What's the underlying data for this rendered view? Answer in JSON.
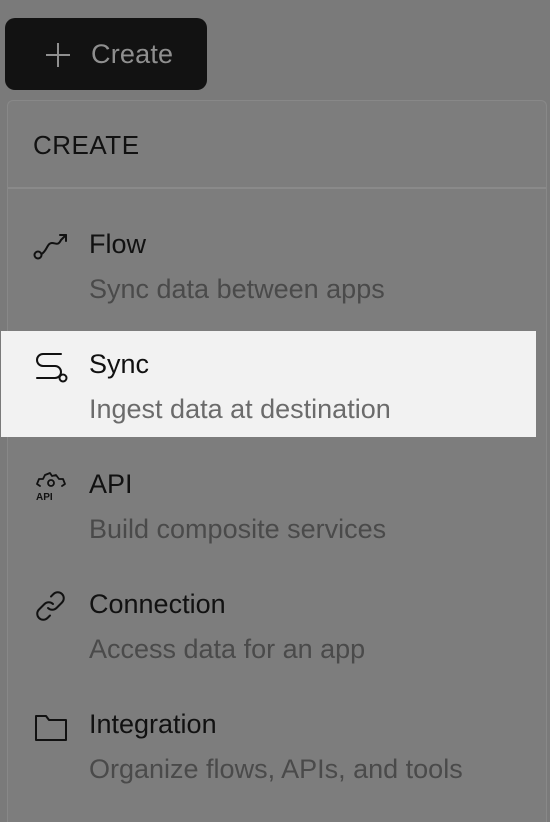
{
  "create_button": {
    "label": "Create",
    "icon": "plus-icon"
  },
  "menu": {
    "header": "CREATE",
    "items": [
      {
        "title": "Flow",
        "description": "Sync data between apps",
        "icon": "flow-icon",
        "active": false
      },
      {
        "title": "Sync",
        "description": "Ingest data at destination",
        "icon": "sync-icon",
        "active": true
      },
      {
        "title": "API",
        "description": "Build composite services",
        "icon": "api-icon",
        "active": false
      },
      {
        "title": "Connection",
        "description": "Access data for an app",
        "icon": "link-icon",
        "active": false
      },
      {
        "title": "Integration",
        "description": "Organize flows, APIs, and tools",
        "icon": "folder-icon",
        "active": false
      }
    ]
  },
  "colors": {
    "overlay": "#7a7a7a",
    "button_bg": "#121212",
    "active_bg": "#f2f2f2"
  }
}
